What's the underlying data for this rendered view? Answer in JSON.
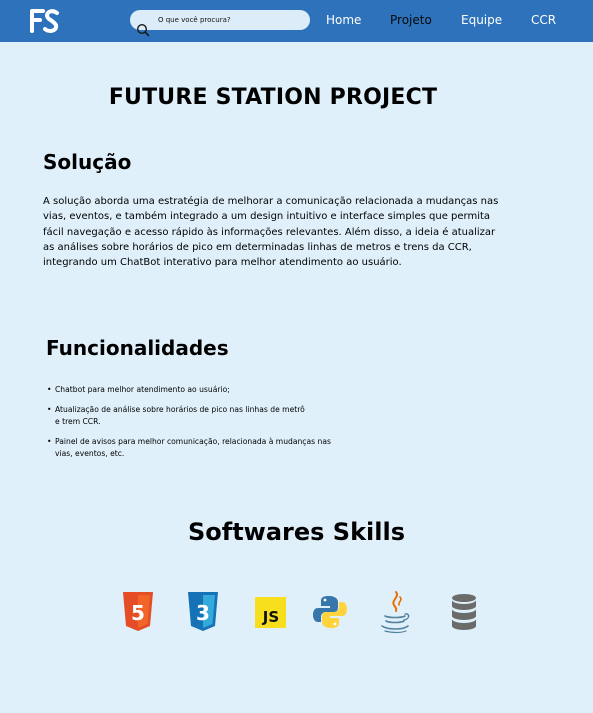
{
  "header": {
    "logo_text": "FS",
    "search_placeholder": "O que você procura?",
    "nav": [
      {
        "label": "Home",
        "active": false
      },
      {
        "label": "Projeto",
        "active": true
      },
      {
        "label": "Equipe",
        "active": false
      },
      {
        "label": "CCR",
        "active": false
      }
    ]
  },
  "page": {
    "title": "FUTURE STATION PROJECT",
    "solution": {
      "heading": "Solução",
      "text": "A solução aborda uma estratégia de melhorar a comunicação relacionada a mudanças nas vias, eventos, e também integrado a um design intuitivo e interface simples que permita fácil navegação e acesso rápido às informações relevantes. Além disso, a ideia é atualizar as análises sobre horários de pico em determinadas linhas de metros e trens da CCR, integrando um ChatBot interativo para melhor atendimento ao usuário."
    },
    "features": {
      "heading": "Funcionalidades",
      "items": [
        "Chatbot para melhor atendimento ao usuário;",
        "Atualização de análise sobre horários de pico nas linhas de metrô e trem CCR.",
        "Painel de avisos para melhor comunicação, relacionada à mudanças nas vias, eventos, etc."
      ]
    },
    "skills": {
      "heading": "Softwares Skills",
      "items": [
        {
          "icon": "html5-icon",
          "label": "5"
        },
        {
          "icon": "css3-icon",
          "label": "3"
        },
        {
          "icon": "javascript-icon",
          "label": "JS"
        },
        {
          "icon": "python-icon"
        },
        {
          "icon": "java-icon"
        },
        {
          "icon": "database-icon"
        }
      ]
    }
  },
  "colors": {
    "header_bg": "#2d72bb",
    "page_bg": "#dff0fa",
    "search_bg": "#dcecf8",
    "html_orange": "#e44d26",
    "css_blue": "#1572b6",
    "js_yellow": "#f7df1e",
    "python_blue": "#3776ab",
    "python_yellow": "#ffd43b",
    "java_blue": "#5382a1",
    "db_gray": "#6b6b6b"
  }
}
